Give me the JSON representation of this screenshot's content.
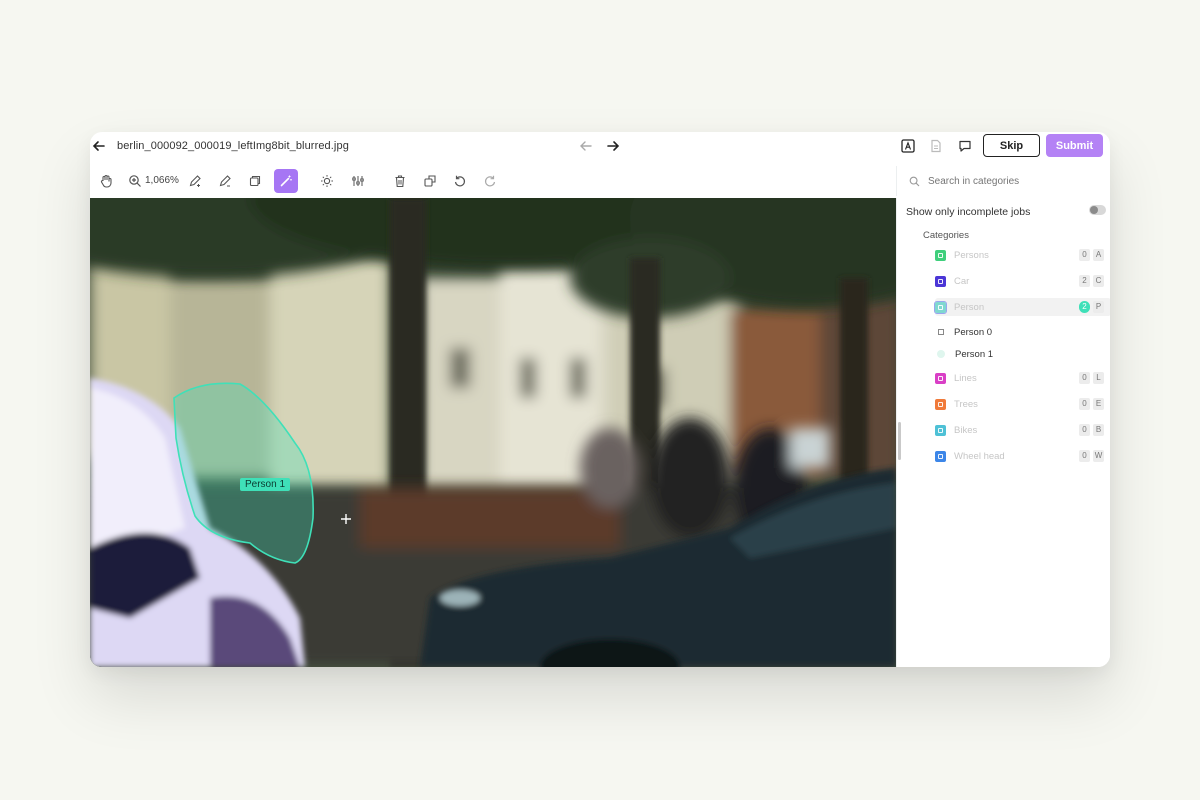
{
  "header": {
    "filename": "berlin_000092_000019_leftImg8bit_blurred.jpg",
    "skip_label": "Skip",
    "submit_label": "Submit"
  },
  "toolbar": {
    "zoom_label": "1,066%"
  },
  "sidebar": {
    "search_placeholder": "Search in categories",
    "incomplete_label": "Show only incomplete jobs",
    "incomplete_enabled": false,
    "categories_title": "Categories",
    "categories": [
      {
        "label": "Persons",
        "color": "#3fcf7c",
        "count": "0",
        "key": "A"
      },
      {
        "label": "Car",
        "color": "#4b36d6",
        "count": "2",
        "key": "C"
      },
      {
        "label": "Person",
        "color": "#7fd8d0",
        "count": "2",
        "key": "P",
        "selected": true
      },
      {
        "label": "Lines",
        "color": "#d93fc6",
        "count": "0",
        "key": "L"
      },
      {
        "label": "Trees",
        "color": "#f07a3a",
        "count": "0",
        "key": "E"
      },
      {
        "label": "Bikes",
        "color": "#4ec1d6",
        "count": "0",
        "key": "B"
      },
      {
        "label": "Wheel head",
        "color": "#3c86e8",
        "count": "0",
        "key": "W"
      }
    ],
    "instances": [
      {
        "label": "Person 0"
      },
      {
        "label": "Person 1"
      }
    ]
  },
  "canvas": {
    "annotation_label": "Person 1",
    "annotation_color": "#3fe0b8"
  },
  "colors": {
    "accent": "#a676f4",
    "submit": "#b482f5"
  }
}
